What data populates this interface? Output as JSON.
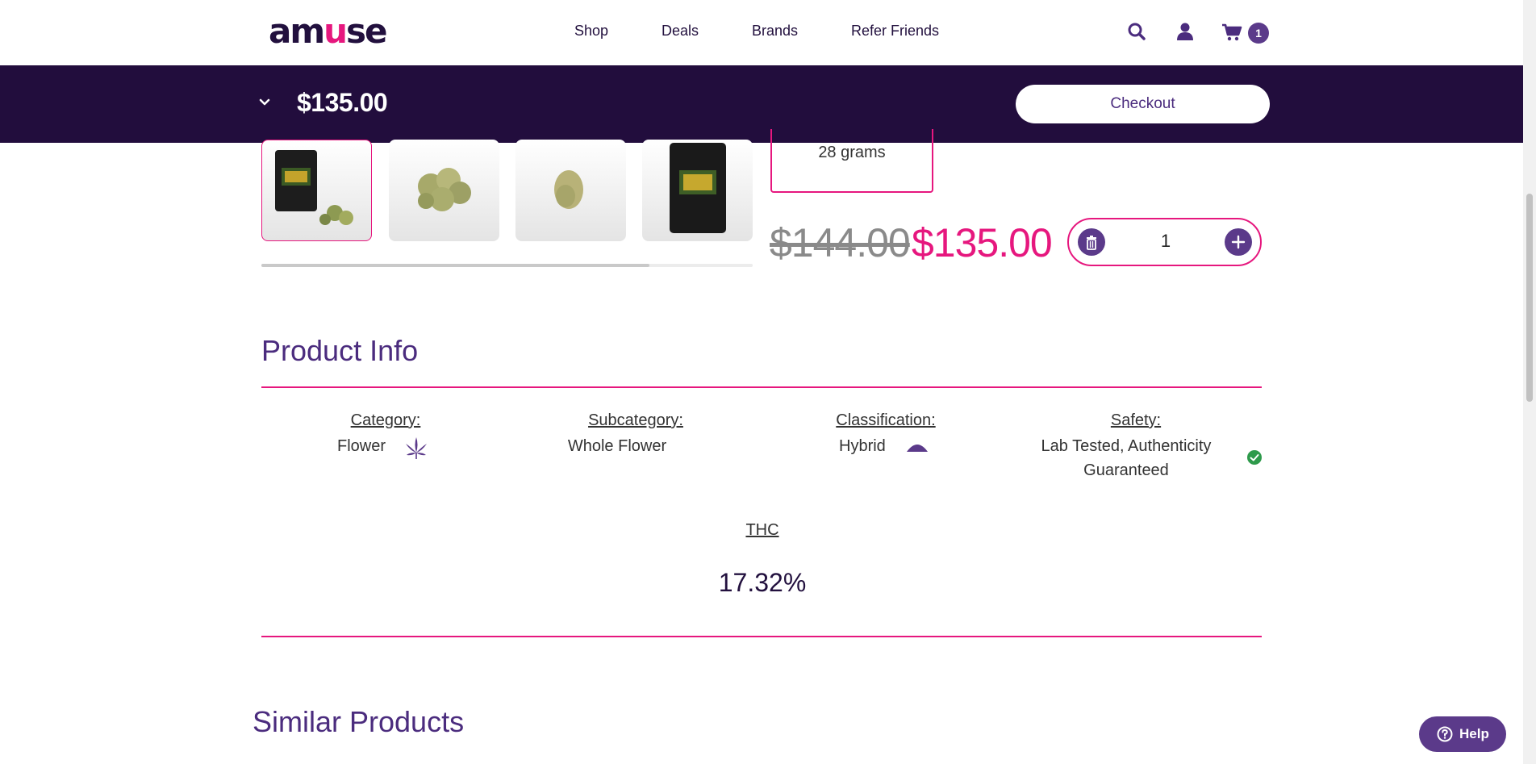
{
  "header": {
    "logo_parts": [
      "am",
      "u",
      "se"
    ],
    "nav": [
      "Shop",
      "Deals",
      "Brands",
      "Refer Friends"
    ],
    "icons": [
      "search-icon",
      "user-icon",
      "cart-icon"
    ],
    "cart_count": "1"
  },
  "sticky_bar": {
    "total": "$135.00",
    "checkout_label": "Checkout"
  },
  "gallery": {
    "thumbnails": [
      "package-front",
      "flower-buds",
      "single-bud",
      "package-back"
    ],
    "selected_index": 0,
    "scroll_progress": 0.79
  },
  "product": {
    "weight": "28 grams",
    "original_price": "$144.00",
    "sale_price": "$135.00",
    "quantity": "1"
  },
  "product_info": {
    "title": "Product Info",
    "category_label": "Category:",
    "category_value": "Flower",
    "subcategory_label": "Subcategory:",
    "subcategory_value": "Whole Flower",
    "classification_label": "Classification:",
    "classification_value": "Hybrid",
    "safety_label": "Safety:",
    "safety_value_line1": "Lab Tested, Authenticity",
    "safety_value_line2": "Guaranteed",
    "thc_label": "THC",
    "thc_value": "17.32%"
  },
  "similar": {
    "title": "Similar Products"
  },
  "help": {
    "label": "Help"
  },
  "colors": {
    "brand_dark": "#220d3d",
    "brand_purple": "#5b3a8a",
    "accent_pink": "#e6177e",
    "success_green": "#2e9a4b"
  }
}
